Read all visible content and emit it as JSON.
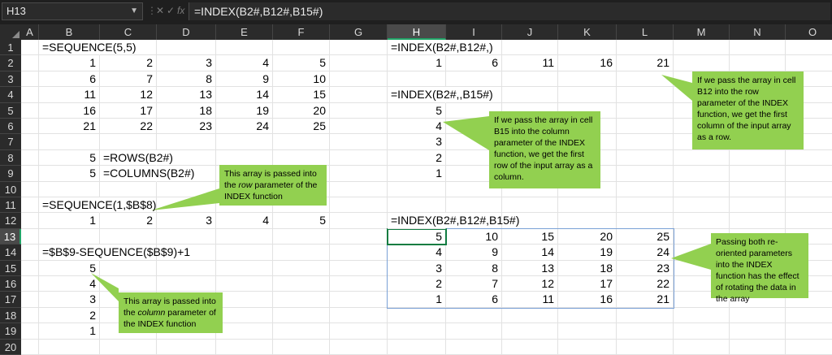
{
  "formula_bar": {
    "name_box": "H13",
    "cancel_glyph": "✕",
    "enter_glyph": "✓",
    "fx_label": "fx",
    "formula": "=INDEX(B2#,B12#,B15#)"
  },
  "columns": [
    "A",
    "B",
    "C",
    "D",
    "E",
    "F",
    "G",
    "H",
    "I",
    "J",
    "K",
    "L",
    "M",
    "N",
    "O"
  ],
  "rows": [
    "1",
    "2",
    "3",
    "4",
    "5",
    "6",
    "7",
    "8",
    "9",
    "10",
    "11",
    "12",
    "13",
    "14",
    "15",
    "16",
    "17",
    "18",
    "19",
    "20"
  ],
  "selected": {
    "column": "H",
    "row": "13"
  },
  "cells": {
    "B1": "=SEQUENCE(5,5)",
    "B2": "1",
    "C2": "2",
    "D2": "3",
    "E2": "4",
    "F2": "5",
    "B3": "6",
    "C3": "7",
    "D3": "8",
    "E3": "9",
    "F3": "10",
    "B4": "11",
    "C4": "12",
    "D4": "13",
    "E4": "14",
    "F4": "15",
    "B5": "16",
    "C5": "17",
    "D5": "18",
    "E5": "19",
    "F5": "20",
    "B6": "21",
    "C6": "22",
    "D6": "23",
    "E6": "24",
    "F6": "25",
    "B8": "5",
    "C8": "=ROWS(B2#)",
    "B9": "5",
    "C9": "=COLUMNS(B2#)",
    "B11": "=SEQUENCE(1,$B$8)",
    "B12": "1",
    "C12": "2",
    "D12": "3",
    "E12": "4",
    "F12": "5",
    "B14": "=$B$9-SEQUENCE($B$9)+1",
    "B15": "5",
    "B16": "4",
    "B17": "3",
    "B18": "2",
    "B19": "1",
    "H1": "=INDEX(B2#,B12#,)",
    "H2": "1",
    "I2": "6",
    "J2": "11",
    "K2": "16",
    "L2": "21",
    "H4": "=INDEX(B2#,,B15#)",
    "H5": "5",
    "H6": "4",
    "H7": "3",
    "H8": "2",
    "H9": "1",
    "H12": "=INDEX(B2#,B12#,B15#)",
    "H13": "5",
    "I13": "10",
    "J13": "15",
    "K13": "20",
    "L13": "25",
    "H14": "4",
    "I14": "9",
    "J14": "14",
    "K14": "19",
    "L14": "24",
    "H15": "3",
    "I15": "8",
    "J15": "13",
    "K15": "18",
    "L15": "23",
    "H16": "2",
    "I16": "7",
    "J16": "12",
    "K16": "17",
    "L16": "22",
    "H17": "1",
    "I17": "6",
    "J17": "11",
    "K17": "16",
    "L17": "21"
  },
  "callouts": {
    "row_note": {
      "before": "This array is passed into the ",
      "em": "row",
      "after": " parameter of the INDEX function"
    },
    "column_note": {
      "before": "This array is passed into the ",
      "em": "column",
      "after": " parameter of the INDEX function"
    },
    "b15_note": "If we pass the array in cell B15 into the column parameter of the INDEX function, we get the first row of the input array as a column.",
    "b12_note": "If we pass the array in cell B12 into the row parameter of the INDEX function, we get the first column of the input array as a row.",
    "rotate_note": "Passing both re-oriented parameters into the INDEX function has the effect of rotating the data in the array"
  },
  "colors": {
    "callout_fill": "#92d050",
    "active_border": "#107c41",
    "header_bg": "#2b2b2b",
    "spill_border": "#7aa1d6"
  },
  "icons": [
    "chevron-down-icon",
    "cancel-icon",
    "enter-icon",
    "function-icon",
    "select-all-icon"
  ]
}
